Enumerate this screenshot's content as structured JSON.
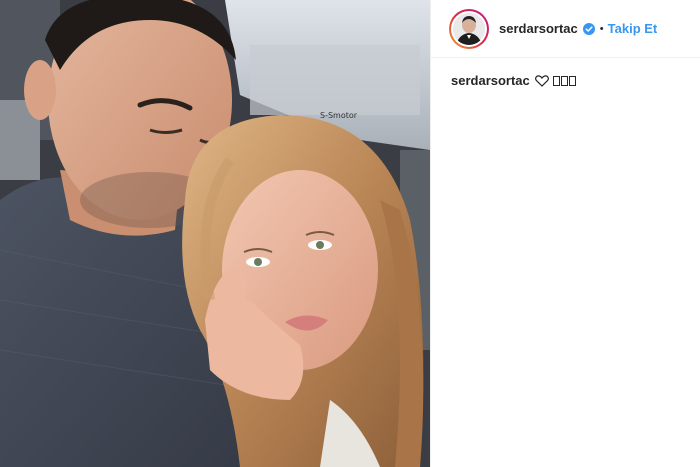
{
  "post": {
    "author": {
      "username": "serdarsortac",
      "verified": true,
      "follow_label": "Takip Et",
      "separator": "•"
    },
    "caption": {
      "username": "serdarsortac",
      "glyphs": [
        "heart-outline-icon",
        "emoji-placeholder-icon",
        "emoji-placeholder-icon",
        "emoji-placeholder-icon"
      ]
    },
    "photo": {
      "car_text": "S-Smotor",
      "description_icon": "selfie-photo"
    }
  },
  "colors": {
    "link_blue": "#3897f0",
    "verified_blue": "#3897f0",
    "text": "#262626",
    "border": "#efefef"
  }
}
